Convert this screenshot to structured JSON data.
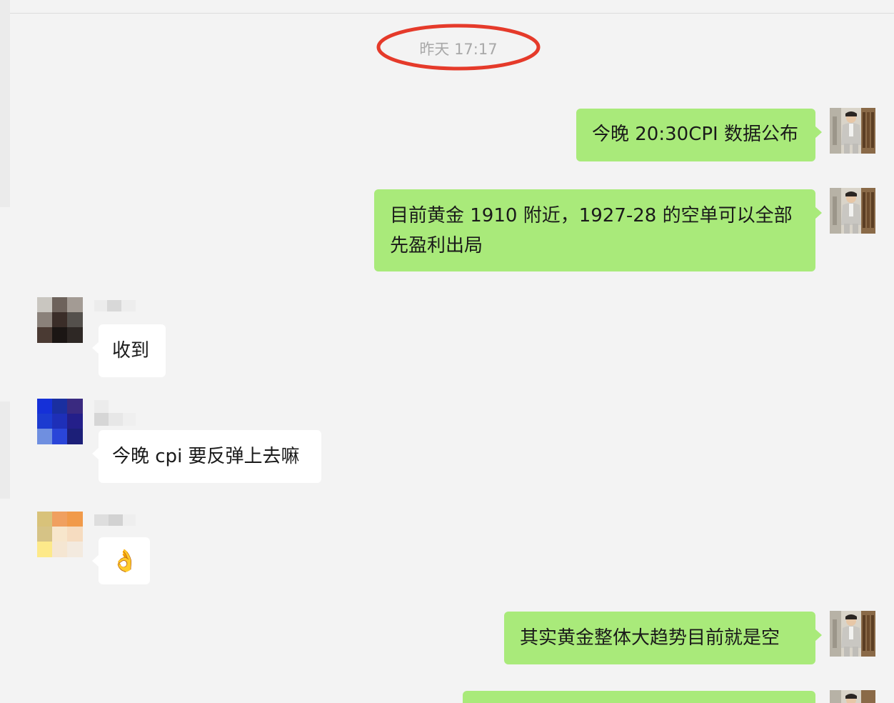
{
  "chat": {
    "timestamp": "昨天 17:17",
    "messages": [
      {
        "id": "m1",
        "direction": "out",
        "lines": [
          "今晚 20:30CPI 数据公布"
        ]
      },
      {
        "id": "m2",
        "direction": "out",
        "lines": [
          "目前黄金 1910 附近，1927-28 的空单可以全部",
          "先盈利出局"
        ]
      },
      {
        "id": "m3",
        "direction": "in",
        "lines": [
          "收到"
        ]
      },
      {
        "id": "m4",
        "direction": "in",
        "lines": [
          "今晚 cpi 要反弹上去嘛"
        ]
      },
      {
        "id": "m5",
        "direction": "in",
        "emoji": "👌",
        "emoji_name": "ok-hand-icon"
      },
      {
        "id": "m6",
        "direction": "out",
        "lines": [
          "其实黄金整体大趋势目前就是空"
        ]
      }
    ]
  },
  "colors": {
    "background": "#f3f3f3",
    "outgoing_bubble": "#a9ea7a",
    "incoming_bubble": "#ffffff",
    "timestamp_text": "#a8a8a8",
    "annotation_circle": "#e53a2a"
  },
  "icons": {
    "self_avatar": "self-avatar",
    "contact_avatar_1": "contact-avatar-pixelated-brown",
    "contact_avatar_2": "contact-avatar-pixelated-blue",
    "contact_avatar_3": "contact-avatar-pixelated-orange"
  }
}
